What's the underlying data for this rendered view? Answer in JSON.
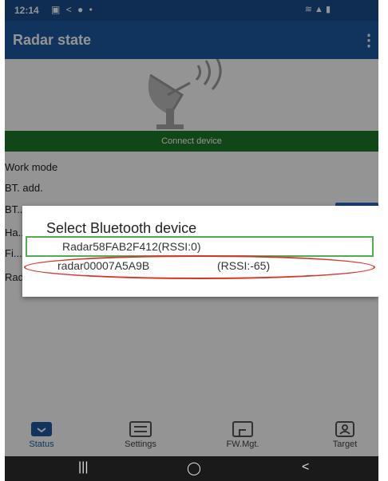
{
  "status_bar": {
    "time": "12:14",
    "left_icons": [
      "gallery-icon",
      "call-icon",
      "messenger-icon",
      "dot-icon"
    ],
    "right_icons": [
      "wifi-icon",
      "signal-icon",
      "battery-icon"
    ]
  },
  "app_bar": {
    "title": "Radar state",
    "menu_icon": "more-vert-icon",
    "menu_glyph": "⋮"
  },
  "main": {
    "connect_label": "Connect device",
    "rows": [
      "Work mode",
      "BT. add.",
      "BT...",
      "Ha...",
      "Fi...",
      "Radar SFN..."
    ]
  },
  "dialog": {
    "title": "Select Bluetooth device",
    "devices": [
      {
        "name": "Radar58FAB2F412(RSSI:0)"
      },
      {
        "name": "radar00007A5A9B",
        "rssi": "(RSSI:-65)"
      }
    ]
  },
  "bottom_nav": {
    "items": [
      {
        "label": "Status",
        "icon": "status-icon"
      },
      {
        "label": "Settings",
        "icon": "settings-list-icon"
      },
      {
        "label": "FW.Mgt.",
        "icon": "fw-management-icon"
      },
      {
        "label": "Target",
        "icon": "target-person-icon"
      }
    ]
  },
  "system_nav": {
    "recents": "|||",
    "home": "◯",
    "back": "<"
  },
  "colors": {
    "app_bar": "#1c5aa3",
    "connect_button": "#1e7a2a",
    "selected_border": "#4caf50",
    "highlight_oval": "#d9342b"
  }
}
